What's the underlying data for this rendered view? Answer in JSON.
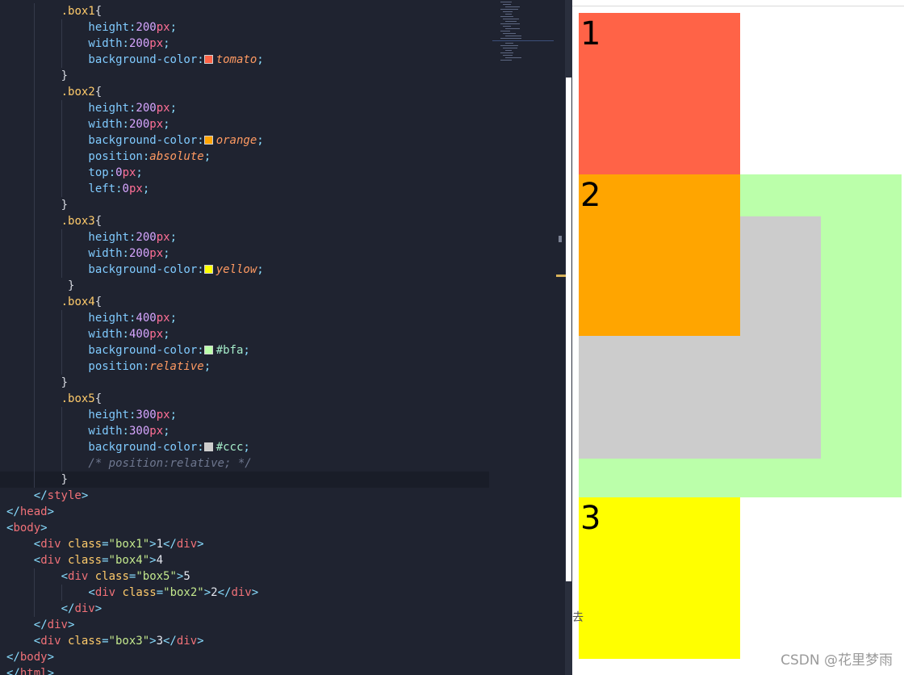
{
  "editor": {
    "lines": [
      {
        "indent": 2,
        "guides": [
          1
        ],
        "tokens": [
          {
            "t": ".box1",
            "c": "sel"
          },
          {
            "t": "{",
            "c": "brace"
          }
        ]
      },
      {
        "indent": 3,
        "guides": [
          1,
          2
        ],
        "tokens": [
          {
            "t": "height",
            "c": "prop"
          },
          {
            "t": ":",
            "c": "punct"
          },
          {
            "t": "200",
            "c": "num"
          },
          {
            "t": "px",
            "c": "unit"
          },
          {
            "t": ";",
            "c": "punct"
          }
        ]
      },
      {
        "indent": 3,
        "guides": [
          1,
          2
        ],
        "tokens": [
          {
            "t": "width",
            "c": "prop"
          },
          {
            "t": ":",
            "c": "punct"
          },
          {
            "t": "200",
            "c": "num"
          },
          {
            "t": "px",
            "c": "unit"
          },
          {
            "t": ";",
            "c": "punct"
          }
        ]
      },
      {
        "indent": 3,
        "guides": [
          1,
          2
        ],
        "tokens": [
          {
            "t": "background-color",
            "c": "prop"
          },
          {
            "t": ":",
            "c": "punct"
          },
          {
            "swatch": "#ff6347"
          },
          {
            "t": "tomato",
            "c": "kw"
          },
          {
            "t": ";",
            "c": "punct"
          }
        ]
      },
      {
        "indent": 2,
        "guides": [
          1
        ],
        "tokens": [
          {
            "t": "}",
            "c": "brace"
          }
        ]
      },
      {
        "indent": 2,
        "guides": [
          1
        ],
        "tokens": [
          {
            "t": ".box2",
            "c": "sel"
          },
          {
            "t": "{",
            "c": "brace"
          }
        ]
      },
      {
        "indent": 3,
        "guides": [
          1,
          2
        ],
        "tokens": [
          {
            "t": "height",
            "c": "prop"
          },
          {
            "t": ":",
            "c": "punct"
          },
          {
            "t": "200",
            "c": "num"
          },
          {
            "t": "px",
            "c": "unit"
          },
          {
            "t": ";",
            "c": "punct"
          }
        ]
      },
      {
        "indent": 3,
        "guides": [
          1,
          2
        ],
        "tokens": [
          {
            "t": "width",
            "c": "prop"
          },
          {
            "t": ":",
            "c": "punct"
          },
          {
            "t": "200",
            "c": "num"
          },
          {
            "t": "px",
            "c": "unit"
          },
          {
            "t": ";",
            "c": "punct"
          }
        ]
      },
      {
        "indent": 3,
        "guides": [
          1,
          2
        ],
        "tokens": [
          {
            "t": "background-color",
            "c": "prop"
          },
          {
            "t": ":",
            "c": "punct"
          },
          {
            "swatch": "#ffa500"
          },
          {
            "t": "orange",
            "c": "kw"
          },
          {
            "t": ";",
            "c": "punct"
          }
        ]
      },
      {
        "indent": 3,
        "guides": [
          1,
          2
        ],
        "tokens": [
          {
            "t": "position",
            "c": "prop"
          },
          {
            "t": ":",
            "c": "punct"
          },
          {
            "t": "absolute",
            "c": "kw"
          },
          {
            "t": ";",
            "c": "punct"
          }
        ]
      },
      {
        "indent": 3,
        "guides": [
          1,
          2
        ],
        "tokens": [
          {
            "t": "top",
            "c": "prop"
          },
          {
            "t": ":",
            "c": "punct"
          },
          {
            "t": "0",
            "c": "num"
          },
          {
            "t": "px",
            "c": "unit"
          },
          {
            "t": ";",
            "c": "punct"
          }
        ]
      },
      {
        "indent": 3,
        "guides": [
          1,
          2
        ],
        "tokens": [
          {
            "t": "left",
            "c": "prop"
          },
          {
            "t": ":",
            "c": "punct"
          },
          {
            "t": "0",
            "c": "num"
          },
          {
            "t": "px",
            "c": "unit"
          },
          {
            "t": ";",
            "c": "punct"
          }
        ]
      },
      {
        "indent": 2,
        "guides": [
          1
        ],
        "tokens": [
          {
            "t": "}",
            "c": "brace"
          }
        ]
      },
      {
        "indent": 2,
        "guides": [
          1
        ],
        "tokens": [
          {
            "t": ".box3",
            "c": "sel"
          },
          {
            "t": "{",
            "c": "brace"
          }
        ]
      },
      {
        "indent": 3,
        "guides": [
          1,
          2
        ],
        "tokens": [
          {
            "t": "height",
            "c": "prop"
          },
          {
            "t": ":",
            "c": "punct"
          },
          {
            "t": "200",
            "c": "num"
          },
          {
            "t": "px",
            "c": "unit"
          },
          {
            "t": ";",
            "c": "punct"
          }
        ]
      },
      {
        "indent": 3,
        "guides": [
          1,
          2
        ],
        "tokens": [
          {
            "t": "width",
            "c": "prop"
          },
          {
            "t": ":",
            "c": "punct"
          },
          {
            "t": "200",
            "c": "num"
          },
          {
            "t": "px",
            "c": "unit"
          },
          {
            "t": ";",
            "c": "punct"
          }
        ]
      },
      {
        "indent": 3,
        "guides": [
          1,
          2
        ],
        "tokens": [
          {
            "t": "background-color",
            "c": "prop"
          },
          {
            "t": ":",
            "c": "punct"
          },
          {
            "swatch": "#ffff00"
          },
          {
            "t": "yellow",
            "c": "kw"
          },
          {
            "t": ";",
            "c": "punct"
          }
        ]
      },
      {
        "indent": 2,
        "guides": [
          1
        ],
        "tokens": [
          {
            "t": " }",
            "c": "brace"
          }
        ]
      },
      {
        "indent": 2,
        "guides": [
          1
        ],
        "tokens": [
          {
            "t": ".box4",
            "c": "sel"
          },
          {
            "t": "{",
            "c": "brace"
          }
        ]
      },
      {
        "indent": 3,
        "guides": [
          1,
          2
        ],
        "tokens": [
          {
            "t": "height",
            "c": "prop"
          },
          {
            "t": ":",
            "c": "punct"
          },
          {
            "t": "400",
            "c": "num"
          },
          {
            "t": "px",
            "c": "unit"
          },
          {
            "t": ";",
            "c": "punct"
          }
        ]
      },
      {
        "indent": 3,
        "guides": [
          1,
          2
        ],
        "tokens": [
          {
            "t": "width",
            "c": "prop"
          },
          {
            "t": ":",
            "c": "punct"
          },
          {
            "t": "400",
            "c": "num"
          },
          {
            "t": "px",
            "c": "unit"
          },
          {
            "t": ";",
            "c": "punct"
          }
        ]
      },
      {
        "indent": 3,
        "guides": [
          1,
          2
        ],
        "tokens": [
          {
            "t": "background-color",
            "c": "prop"
          },
          {
            "t": ":",
            "c": "punct"
          },
          {
            "swatch": "#bbffaa"
          },
          {
            "t": "#bfa",
            "c": "hex"
          },
          {
            "t": ";",
            "c": "punct"
          }
        ]
      },
      {
        "indent": 3,
        "guides": [
          1,
          2
        ],
        "tokens": [
          {
            "t": "position",
            "c": "prop"
          },
          {
            "t": ":",
            "c": "punct"
          },
          {
            "t": "relative",
            "c": "kw"
          },
          {
            "t": ";",
            "c": "punct"
          }
        ]
      },
      {
        "indent": 2,
        "guides": [
          1
        ],
        "tokens": [
          {
            "t": "}",
            "c": "brace"
          }
        ]
      },
      {
        "indent": 2,
        "guides": [
          1
        ],
        "tokens": [
          {
            "t": ".box5",
            "c": "sel"
          },
          {
            "t": "{",
            "c": "brace"
          }
        ]
      },
      {
        "indent": 3,
        "guides": [
          1,
          2
        ],
        "tokens": [
          {
            "t": "height",
            "c": "prop"
          },
          {
            "t": ":",
            "c": "punct"
          },
          {
            "t": "300",
            "c": "num"
          },
          {
            "t": "px",
            "c": "unit"
          },
          {
            "t": ";",
            "c": "punct"
          }
        ]
      },
      {
        "indent": 3,
        "guides": [
          1,
          2
        ],
        "tokens": [
          {
            "t": "width",
            "c": "prop"
          },
          {
            "t": ":",
            "c": "punct"
          },
          {
            "t": "300",
            "c": "num"
          },
          {
            "t": "px",
            "c": "unit"
          },
          {
            "t": ";",
            "c": "punct"
          }
        ]
      },
      {
        "indent": 3,
        "guides": [
          1,
          2
        ],
        "tokens": [
          {
            "t": "background-color",
            "c": "prop"
          },
          {
            "t": ":",
            "c": "punct"
          },
          {
            "swatch": "#cccccc"
          },
          {
            "t": "#ccc",
            "c": "hex"
          },
          {
            "t": ";",
            "c": "punct"
          }
        ]
      },
      {
        "indent": 3,
        "guides": [
          1,
          2
        ],
        "tokens": [
          {
            "t": "/* position:relative; */",
            "c": "comment"
          }
        ]
      },
      {
        "indent": 2,
        "guides": [
          1
        ],
        "current": true,
        "tokens": [
          {
            "t": "}",
            "c": "brace"
          }
        ]
      },
      {
        "indent": 1,
        "guides": [],
        "tokens": [
          {
            "t": "</",
            "c": "bracket"
          },
          {
            "t": "style",
            "c": "tag"
          },
          {
            "t": ">",
            "c": "bracket"
          }
        ]
      },
      {
        "indent": 0,
        "guides": [],
        "tokens": [
          {
            "t": "</",
            "c": "bracket"
          },
          {
            "t": "head",
            "c": "tag"
          },
          {
            "t": ">",
            "c": "bracket"
          }
        ]
      },
      {
        "indent": 0,
        "guides": [],
        "tokens": [
          {
            "t": "<",
            "c": "bracket"
          },
          {
            "t": "body",
            "c": "tag"
          },
          {
            "t": ">",
            "c": "bracket"
          }
        ]
      },
      {
        "indent": 1,
        "guides": [],
        "tokens": [
          {
            "t": "<",
            "c": "bracket"
          },
          {
            "t": "div",
            "c": "tag"
          },
          {
            "t": " class",
            "c": "attr"
          },
          {
            "t": "=",
            "c": "punct"
          },
          {
            "t": "\"box1\"",
            "c": "str"
          },
          {
            "t": ">",
            "c": "bracket"
          },
          {
            "t": "1",
            "c": "text"
          },
          {
            "t": "</",
            "c": "bracket"
          },
          {
            "t": "div",
            "c": "tag"
          },
          {
            "t": ">",
            "c": "bracket"
          }
        ]
      },
      {
        "indent": 1,
        "guides": [],
        "tokens": [
          {
            "t": "<",
            "c": "bracket"
          },
          {
            "t": "div",
            "c": "tag"
          },
          {
            "t": " class",
            "c": "attr"
          },
          {
            "t": "=",
            "c": "punct"
          },
          {
            "t": "\"box4\"",
            "c": "str"
          },
          {
            "t": ">",
            "c": "bracket"
          },
          {
            "t": "4",
            "c": "text"
          }
        ]
      },
      {
        "indent": 2,
        "guides": [
          1
        ],
        "tokens": [
          {
            "t": "<",
            "c": "bracket"
          },
          {
            "t": "div",
            "c": "tag"
          },
          {
            "t": " class",
            "c": "attr"
          },
          {
            "t": "=",
            "c": "punct"
          },
          {
            "t": "\"box5\"",
            "c": "str"
          },
          {
            "t": ">",
            "c": "bracket"
          },
          {
            "t": "5",
            "c": "text"
          }
        ]
      },
      {
        "indent": 3,
        "guides": [
          1,
          2
        ],
        "tokens": [
          {
            "t": "<",
            "c": "bracket"
          },
          {
            "t": "div",
            "c": "tag"
          },
          {
            "t": " class",
            "c": "attr"
          },
          {
            "t": "=",
            "c": "punct"
          },
          {
            "t": "\"box2\"",
            "c": "str"
          },
          {
            "t": ">",
            "c": "bracket"
          },
          {
            "t": "2",
            "c": "text"
          },
          {
            "t": "</",
            "c": "bracket"
          },
          {
            "t": "div",
            "c": "tag"
          },
          {
            "t": ">",
            "c": "bracket"
          }
        ]
      },
      {
        "indent": 2,
        "guides": [
          1
        ],
        "tokens": [
          {
            "t": "</",
            "c": "bracket"
          },
          {
            "t": "div",
            "c": "tag"
          },
          {
            "t": ">",
            "c": "bracket"
          }
        ]
      },
      {
        "indent": 1,
        "guides": [],
        "tokens": [
          {
            "t": "</",
            "c": "bracket"
          },
          {
            "t": "div",
            "c": "tag"
          },
          {
            "t": ">",
            "c": "bracket"
          }
        ]
      },
      {
        "indent": 1,
        "guides": [],
        "tokens": [
          {
            "t": "<",
            "c": "bracket"
          },
          {
            "t": "div",
            "c": "tag"
          },
          {
            "t": " class",
            "c": "attr"
          },
          {
            "t": "=",
            "c": "punct"
          },
          {
            "t": "\"box3\"",
            "c": "str"
          },
          {
            "t": ">",
            "c": "bracket"
          },
          {
            "t": "3",
            "c": "text"
          },
          {
            "t": "</",
            "c": "bracket"
          },
          {
            "t": "div",
            "c": "tag"
          },
          {
            "t": ">",
            "c": "bracket"
          }
        ]
      },
      {
        "indent": 0,
        "guides": [],
        "tokens": [
          {
            "t": "</",
            "c": "bracket"
          },
          {
            "t": "body",
            "c": "tag"
          },
          {
            "t": ">",
            "c": "bracket"
          }
        ]
      },
      {
        "indent": 0,
        "guides": [],
        "tokens": [
          {
            "t": "</",
            "c": "bracket"
          },
          {
            "t": "html",
            "c": "tag"
          },
          {
            "t": ">",
            "c": "bracket"
          }
        ]
      }
    ]
  },
  "preview": {
    "box1_label": "1",
    "box2_label": "2",
    "box3_label": "3",
    "box1_color": "#ff6347",
    "box2_color": "#ffa500",
    "box3_color": "#ffff00",
    "box4_color": "#bbffaa",
    "box5_color": "#cccccc",
    "clipped_char": "去"
  },
  "watermark": "CSDN @花里梦雨"
}
